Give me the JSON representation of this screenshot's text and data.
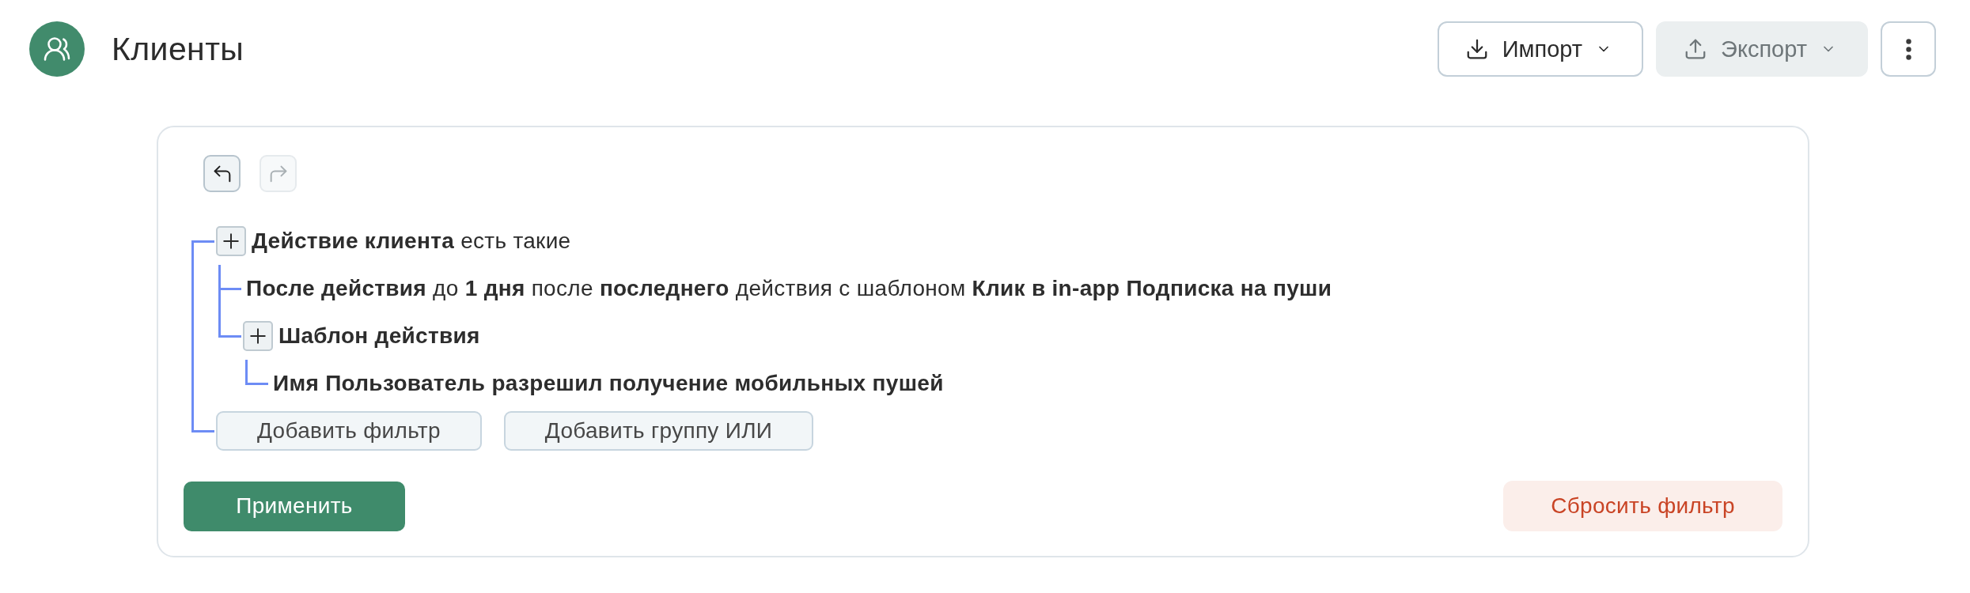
{
  "header": {
    "title": "Клиенты",
    "actions": [
      {
        "kind": "import",
        "label": "Импорт",
        "disabled": false
      },
      {
        "kind": "export",
        "label": "Экспорт",
        "disabled": true
      }
    ]
  },
  "filter_panel": {
    "history": [
      {
        "kind": "undo",
        "disabled": false
      },
      {
        "kind": "redo",
        "disabled": true
      }
    ],
    "tree": {
      "children": [
        {
          "kind": "group",
          "label": "Действие клиента",
          "text": "есть такие",
          "children": [
            {
              "kind": "condition",
              "text": "**После действия** до **1 дня** после **последнего** действия с шаблоном **Клик в in-app Подписка на пуши**"
            },
            {
              "kind": "group",
              "label": "Шаблон действия",
              "children": [
                {
                  "kind": "condition",
                  "label": "Имя Пользователь разрешил получение мобильных пушей"
                }
              ]
            }
          ]
        }
      ],
      "add_buttons": [
        "Добавить фильтр",
        "Добавить группу ИЛИ"
      ]
    },
    "apply_button": "Применить",
    "reset_button": "Сбросить фильтр"
  }
}
